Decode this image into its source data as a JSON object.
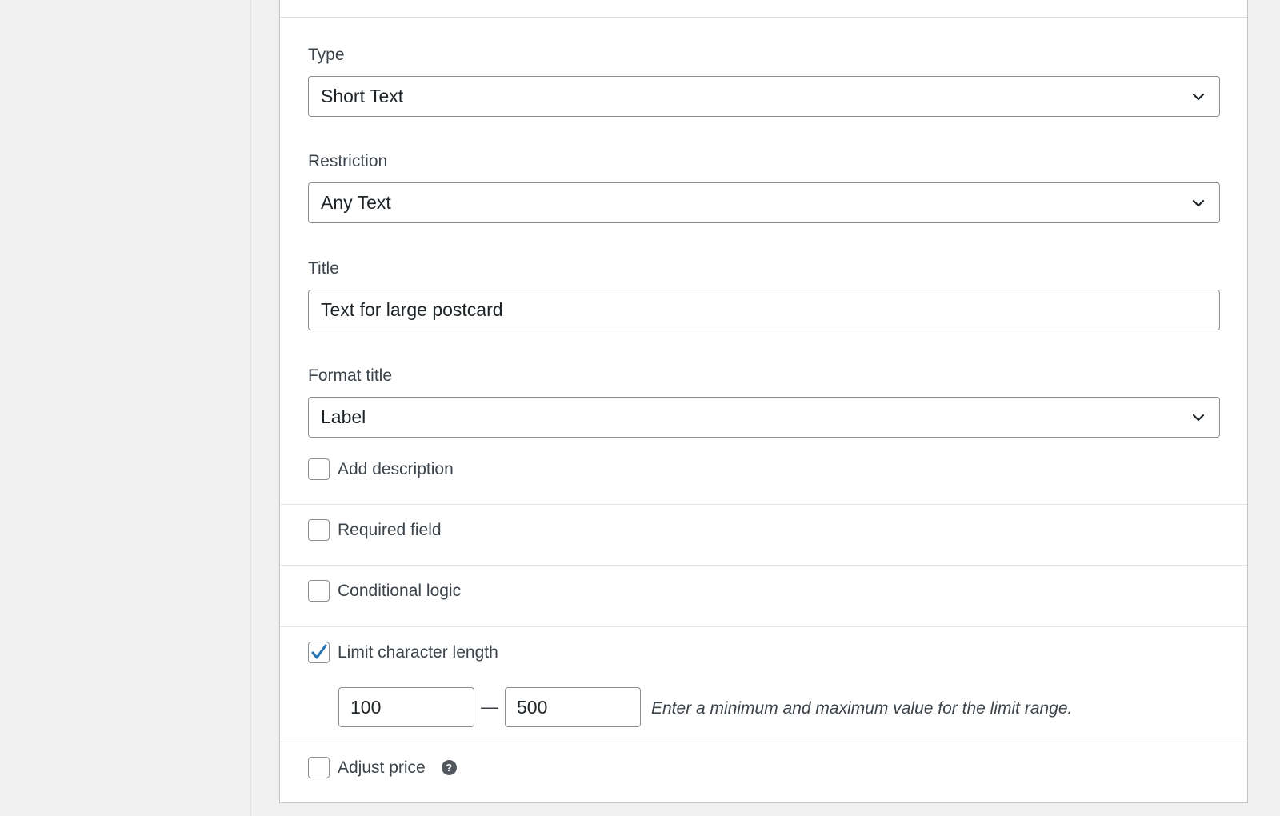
{
  "form": {
    "type": {
      "label": "Type",
      "value": "Short Text"
    },
    "restriction": {
      "label": "Restriction",
      "value": "Any Text"
    },
    "title": {
      "label": "Title",
      "value": "Text for large postcard"
    },
    "format_title": {
      "label": "Format title",
      "value": "Label"
    },
    "add_description": {
      "label": "Add description",
      "checked": false
    },
    "required_field": {
      "label": "Required field",
      "checked": false
    },
    "conditional_logic": {
      "label": "Conditional logic",
      "checked": false
    },
    "limit_length": {
      "label": "Limit character length",
      "checked": true,
      "min": "100",
      "max": "500",
      "separator": "—",
      "hint": "Enter a minimum and maximum value for the limit range."
    },
    "adjust_price": {
      "label": "Adjust price",
      "checked": false,
      "help_glyph": "?"
    }
  },
  "colors": {
    "checkmark": "#2271b1",
    "border": "#8c8f94",
    "background": "#f0f0f1"
  },
  "icons": [
    "chevron-down-icon",
    "checkmark-icon",
    "help-icon"
  ]
}
